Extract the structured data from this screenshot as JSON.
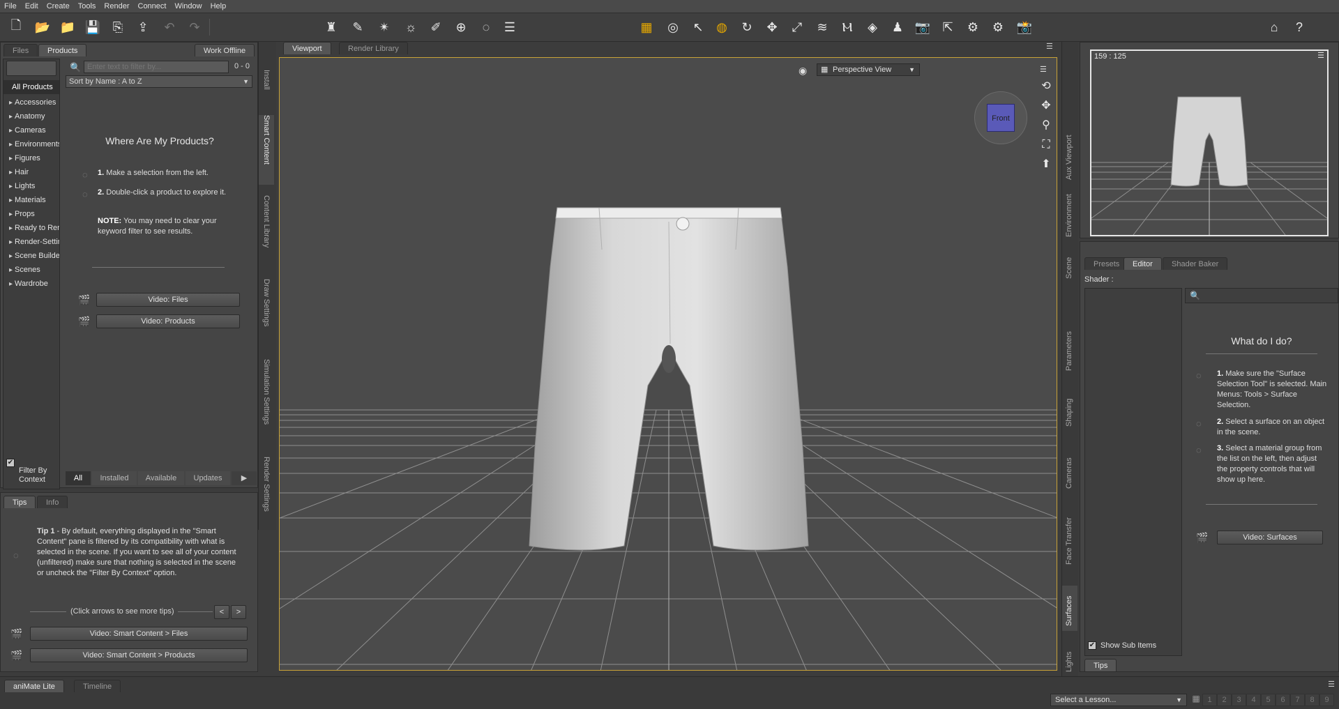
{
  "menu": [
    "File",
    "Edit",
    "Create",
    "Tools",
    "Render",
    "Connect",
    "Window",
    "Help"
  ],
  "toolbar_icons": [
    "new-file-icon",
    "open-file-icon",
    "merge-file-icon",
    "save-icon",
    "import-icon",
    "export-icon",
    "undo-icon",
    "redo-icon",
    "new-figure-icon",
    "light-icon",
    "spotlight-icon",
    "distant-light-icon",
    "point-light-icon",
    "camera-light-icon",
    "node-icon",
    "group-icon",
    "align-icon",
    "active-pose-tool-icon",
    "universal-tool-icon",
    "node-selection-icon",
    "rotate-icon",
    "translate-icon",
    "scale-icon",
    "joint-editor-icon",
    "geometry-editor-icon",
    "surface-tool-icon",
    "figure-setup-icon",
    "camera-tool-icon",
    "region-nav-icon",
    "power-pose-icon",
    "spot-render-icon",
    "render-icon",
    "home-icon",
    "help-icon"
  ],
  "left_panel": {
    "tabs": [
      "Files",
      "Products"
    ],
    "work_offline": "Work Offline",
    "filter_placeholder": "Enter text to filter by...",
    "filter_count": "0 - 0",
    "sort_label": "Sort by Name : A to Z",
    "all_products": "All Products",
    "categories": [
      "Accessories",
      "Anatomy",
      "Cameras",
      "Environments",
      "Figures",
      "Hair",
      "Lights",
      "Materials",
      "Props",
      "Ready to Render",
      "Render-Settings",
      "Scene Builder",
      "Scenes",
      "Wardrobe"
    ],
    "where_title": "Where Are My Products?",
    "step1_num": "1.",
    "step1_text": "Make a selection from the left.",
    "step2_num": "2.",
    "step2_text": "Double-click a product to explore it.",
    "note_label": "NOTE:",
    "note_text": "You may need to clear your keyword filter to see results.",
    "video_files": "Video: Files",
    "video_products": "Video: Products",
    "filter_by_context": "Filter By Context",
    "bottom_tabs": [
      "All",
      "Installed",
      "Available",
      "Updates"
    ],
    "vertical_tabs": [
      "Install",
      "Smart Content",
      "Content Library",
      "Draw Settings",
      "Simulation Settings",
      "Render Settings"
    ]
  },
  "tips_panel": {
    "tabs": [
      "Tips",
      "Info"
    ],
    "tip_label": "Tip 1",
    "tip_text": " - By default, everything displayed in the \"Smart Content\" pane is filtered by its compatibility with what is selected in the scene. If you want to see all of your content (unfiltered) make sure that nothing is selected in the scene or uncheck the \"Filter By Context\" option.",
    "arrows_hint": "(Click arrows to see more tips)",
    "prev": "<",
    "next": ">",
    "video_sc_files": "Video: Smart Content > Files",
    "video_sc_products": "Video: Smart Content > Products"
  },
  "viewport": {
    "tabs": [
      "Viewport",
      "Render Library"
    ],
    "view_label": "Perspective View",
    "cube_label": "Front"
  },
  "aux": {
    "coords": "159 : 125",
    "vertical_tabs": [
      "Aux Viewport",
      "Environment",
      "Scene"
    ]
  },
  "surfaces": {
    "tabs": [
      "Presets",
      "Editor",
      "Shader Baker"
    ],
    "shader_label": "Shader :",
    "title": "What do I do?",
    "step1_num": "1.",
    "step1_text": "Make sure the \"Surface Selection Tool\" is selected. Main Menus: Tools > Surface Selection.",
    "step2_num": "2.",
    "step2_text": "Select a surface on an object in the scene.",
    "step3_num": "3.",
    "step3_text": "Select a material group from the list on the left, then adjust the property controls that will show up here.",
    "video_surfaces": "Video: Surfaces",
    "show_sub_items": "Show Sub Items",
    "tips_tab": "Tips",
    "vertical_tabs": [
      "Parameters",
      "Shaping",
      "Cameras",
      "Face Transfer",
      "Surfaces",
      "Lights"
    ]
  },
  "bottom": {
    "tabs": [
      "aniMate Lite",
      "Timeline"
    ],
    "lesson": "Select a Lesson...",
    "pages": [
      "1",
      "2",
      "3",
      "4",
      "5",
      "6",
      "7",
      "8",
      "9"
    ]
  }
}
